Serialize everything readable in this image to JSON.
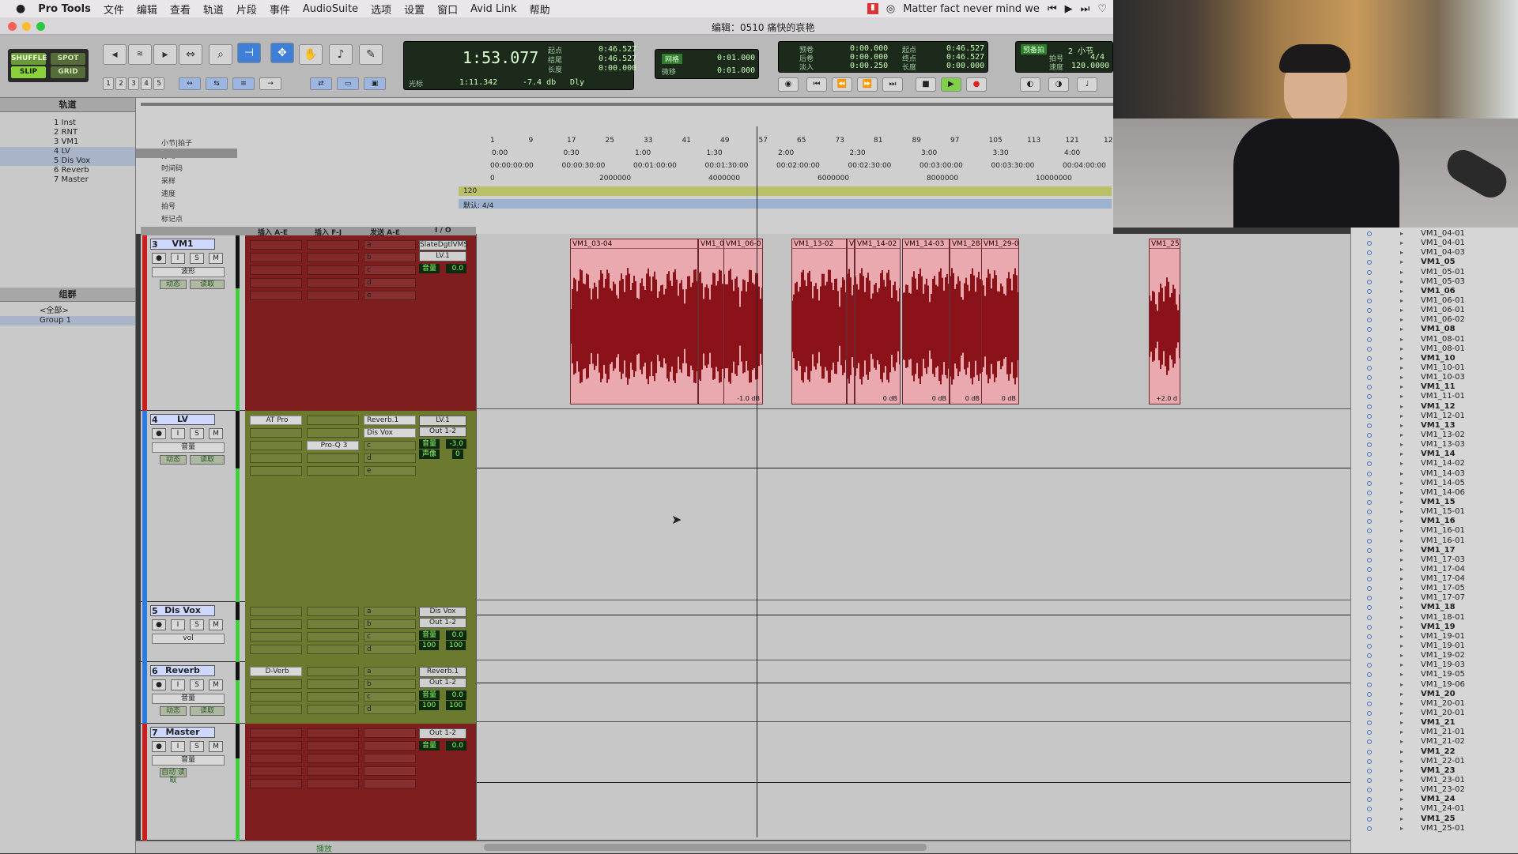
{
  "menubar": {
    "app": "Pro Tools",
    "items": [
      "文件",
      "编辑",
      "查看",
      "轨道",
      "片段",
      "事件",
      "AudioSuite",
      "选项",
      "设置",
      "窗口",
      "Avid Link",
      "帮助"
    ],
    "now_playing": "Matter fact never mind we"
  },
  "window": {
    "title": "编辑：0510 痛快的哀艳"
  },
  "modes": {
    "shuffle": "SHUFFLE",
    "spot": "SPOT",
    "slip": "SLIP",
    "grid": "GRID"
  },
  "zoom_presets": [
    "1",
    "2",
    "3",
    "4",
    "5"
  ],
  "main_counter": {
    "value": "1:53.077",
    "start_label": "起点",
    "start": "0:46.527",
    "end_label": "结尾",
    "end": "0:46.527",
    "length_label": "长度",
    "length": "0:00.000",
    "cursor_label": "光标",
    "cursor": "1:11.342",
    "db": "-7.4 db",
    "dly": "Dly"
  },
  "nudge": {
    "grid_label": "网格",
    "grid": "0:01.000",
    "nudge_label": "微移",
    "nudge": "0:01.000"
  },
  "sub_counter": {
    "pre_label": "预卷",
    "pre": "0:00.000",
    "post_label": "后卷",
    "post": "0:00.000",
    "fade_label": "淡入",
    "fade": "0:00.250",
    "start_label": "起点",
    "start": "0:46.527",
    "end_label": "终点",
    "end": "0:46.527",
    "length_label": "长度",
    "length": "0:00.000"
  },
  "tempo_box": {
    "count_in": "预备拍",
    "meter_label": "拍号",
    "meter": "4/4",
    "tempo_label": "速度",
    "tempo": "120.0000",
    "bars": "2 小节"
  },
  "left_panel": {
    "tracks_header": "轨道",
    "tracks": [
      "1 Inst",
      "2 RNT",
      "3 VM1",
      "4 LV",
      "5 Dis Vox",
      "6 Reverb",
      "7 Master"
    ],
    "groups_header": "组群",
    "groups": [
      "<全部>",
      "Group 1"
    ]
  },
  "rulers": {
    "labels": [
      "小节|拍子",
      "分:秒",
      "时间码",
      "采样",
      "速度",
      "拍号",
      "标记点"
    ],
    "bars": [
      "1",
      "9",
      "17",
      "25",
      "33",
      "41",
      "49",
      "57",
      "65",
      "73",
      "81",
      "89",
      "97",
      "105",
      "113",
      "121",
      "129"
    ],
    "minsecs": [
      "0:00",
      "0:30",
      "1:00",
      "1:30",
      "2:00",
      "2:30",
      "3:00",
      "3:30",
      "4:00"
    ],
    "timecodes": [
      "00:00:00:00",
      "00:00:30:00",
      "00:01:00:00",
      "00:01:30:00",
      "00:02:00:00",
      "00:02:30:00",
      "00:03:00:00",
      "00:03:30:00",
      "00:04:00:00"
    ],
    "samples": [
      "0",
      "2000000",
      "4000000",
      "6000000",
      "8000000",
      "10000000"
    ],
    "tempo": "120",
    "meter": "默认: 4/4"
  },
  "mix_header": {
    "inserts_ae": "插入 A-E",
    "inserts_fj": "插入 F-J",
    "sends_ae": "发送 A-E",
    "io": "I / O"
  },
  "tracks": [
    {
      "num": "3",
      "name": "VM1",
      "view": "波形",
      "auto": "动态",
      "read": "读取",
      "input": "SlateDgtlVMS",
      "output": "LV.1",
      "vol_label": "音量",
      "vol": "0.0",
      "sends": [
        "a",
        "b",
        "c",
        "d",
        "e"
      ],
      "inserts": [],
      "color": "#c81e1e"
    },
    {
      "num": "4",
      "name": "LV",
      "view": "音量",
      "auto": "动态",
      "read": "读取",
      "input": "LV.1",
      "output": "Out 1-2",
      "vol_label": "音量",
      "vol": "-3.0",
      "pan_label": "声像",
      "pan": "0",
      "inserts": [
        "AT Pro",
        "Pro-Q 3"
      ],
      "sends": [
        "Reverb.1",
        "Dis Vox",
        "c",
        "d",
        "e"
      ],
      "color": "#2e7be0"
    },
    {
      "num": "5",
      "name": "Dis Vox",
      "view": "vol",
      "input": "Dis Vox",
      "output": "Out 1-2",
      "vol_label": "音量",
      "vol": "0.0",
      "pan_l": "100",
      "pan_r": "100",
      "inserts": [],
      "sends": [
        "a",
        "b",
        "c",
        "d"
      ],
      "color": "#2e7be0"
    },
    {
      "num": "6",
      "name": "Reverb",
      "view": "音量",
      "auto": "动态",
      "read": "读取",
      "input": "Reverb.1",
      "output": "Out 1-2",
      "vol_label": "音量",
      "vol": "0.0",
      "pan_l": "100",
      "pan_r": "100",
      "inserts": [
        "D-Verb"
      ],
      "sends": [
        "a",
        "b",
        "c",
        "d",
        "e"
      ],
      "color": "#2e7be0"
    },
    {
      "num": "7",
      "name": "Master",
      "view": "音量",
      "auto": "自动 读取",
      "output": "Out 1-2",
      "vol_label": "音量",
      "vol": "0.0",
      "inserts": [],
      "sends": [],
      "color": "#c81e1e"
    }
  ],
  "clips": [
    {
      "name": "VM1_03-04",
      "gain": ""
    },
    {
      "name": "VM1_0",
      "gain": ""
    },
    {
      "name": "VM1_06-0",
      "gain": "-1.0 dB"
    },
    {
      "name": "VM1_13-02",
      "gain": ""
    },
    {
      "name": "V",
      "gain": ""
    },
    {
      "name": "VM1_14-02",
      "gain": "0 dB"
    },
    {
      "name": "VM1_14-03",
      "gain": "0 dB"
    },
    {
      "name": "VM1_28-0",
      "gain": "0 dB"
    },
    {
      "name": "VM1_29-01",
      "gain": "0 dB"
    },
    {
      "name": "VM1_25-",
      "gain": "+2.0 d"
    }
  ],
  "clip_list": [
    {
      "t": "VM1_04-01",
      "b": false
    },
    {
      "t": "VM1_04-01",
      "b": false
    },
    {
      "t": "VM1_04-03",
      "b": false
    },
    {
      "t": "VM1_05",
      "b": true
    },
    {
      "t": "VM1_05-01",
      "b": false
    },
    {
      "t": "VM1_05-03",
      "b": false
    },
    {
      "t": "VM1_06",
      "b": true
    },
    {
      "t": "VM1_06-01",
      "b": false
    },
    {
      "t": "VM1_06-01",
      "b": false
    },
    {
      "t": "VM1_06-02",
      "b": false
    },
    {
      "t": "VM1_08",
      "b": true
    },
    {
      "t": "VM1_08-01",
      "b": false
    },
    {
      "t": "VM1_08-01",
      "b": false
    },
    {
      "t": "VM1_10",
      "b": true
    },
    {
      "t": "VM1_10-01",
      "b": false
    },
    {
      "t": "VM1_10-03",
      "b": false
    },
    {
      "t": "VM1_11",
      "b": true
    },
    {
      "t": "VM1_11-01",
      "b": false
    },
    {
      "t": "VM1_12",
      "b": true
    },
    {
      "t": "VM1_12-01",
      "b": false
    },
    {
      "t": "VM1_13",
      "b": true
    },
    {
      "t": "VM1_13-02",
      "b": false
    },
    {
      "t": "VM1_13-03",
      "b": false
    },
    {
      "t": "VM1_14",
      "b": true
    },
    {
      "t": "VM1_14-02",
      "b": false
    },
    {
      "t": "VM1_14-03",
      "b": false
    },
    {
      "t": "VM1_14-05",
      "b": false
    },
    {
      "t": "VM1_14-06",
      "b": false
    },
    {
      "t": "VM1_15",
      "b": true
    },
    {
      "t": "VM1_15-01",
      "b": false
    },
    {
      "t": "VM1_16",
      "b": true
    },
    {
      "t": "VM1_16-01",
      "b": false
    },
    {
      "t": "VM1_16-01",
      "b": false
    },
    {
      "t": "VM1_17",
      "b": true
    },
    {
      "t": "VM1_17-03",
      "b": false
    },
    {
      "t": "VM1_17-04",
      "b": false
    },
    {
      "t": "VM1_17-04",
      "b": false
    },
    {
      "t": "VM1_17-05",
      "b": false
    },
    {
      "t": "VM1_17-07",
      "b": false
    },
    {
      "t": "VM1_18",
      "b": true
    },
    {
      "t": "VM1_18-01",
      "b": false
    },
    {
      "t": "VM1_19",
      "b": true
    },
    {
      "t": "VM1_19-01",
      "b": false
    },
    {
      "t": "VM1_19-01",
      "b": false
    },
    {
      "t": "VM1_19-02",
      "b": false
    },
    {
      "t": "VM1_19-03",
      "b": false
    },
    {
      "t": "VM1_19-05",
      "b": false
    },
    {
      "t": "VM1_19-06",
      "b": false
    },
    {
      "t": "VM1_20",
      "b": true
    },
    {
      "t": "VM1_20-01",
      "b": false
    },
    {
      "t": "VM1_20-01",
      "b": false
    },
    {
      "t": "VM1_21",
      "b": true
    },
    {
      "t": "VM1_21-01",
      "b": false
    },
    {
      "t": "VM1_21-02",
      "b": false
    },
    {
      "t": "VM1_22",
      "b": true
    },
    {
      "t": "VM1_22-01",
      "b": false
    },
    {
      "t": "VM1_23",
      "b": true
    },
    {
      "t": "VM1_23-01",
      "b": false
    },
    {
      "t": "VM1_23-02",
      "b": false
    },
    {
      "t": "VM1_24",
      "b": true
    },
    {
      "t": "VM1_24-01",
      "b": false
    },
    {
      "t": "VM1_25",
      "b": true
    },
    {
      "t": "VM1_25-01",
      "b": false
    }
  ],
  "bottom": {
    "play_label": "播放"
  },
  "colors": {
    "clip_fill": "#e9a9ae",
    "waveform": "#8b1218",
    "red_strip": "#7e1e1e",
    "green_strip": "#6c7a30"
  }
}
